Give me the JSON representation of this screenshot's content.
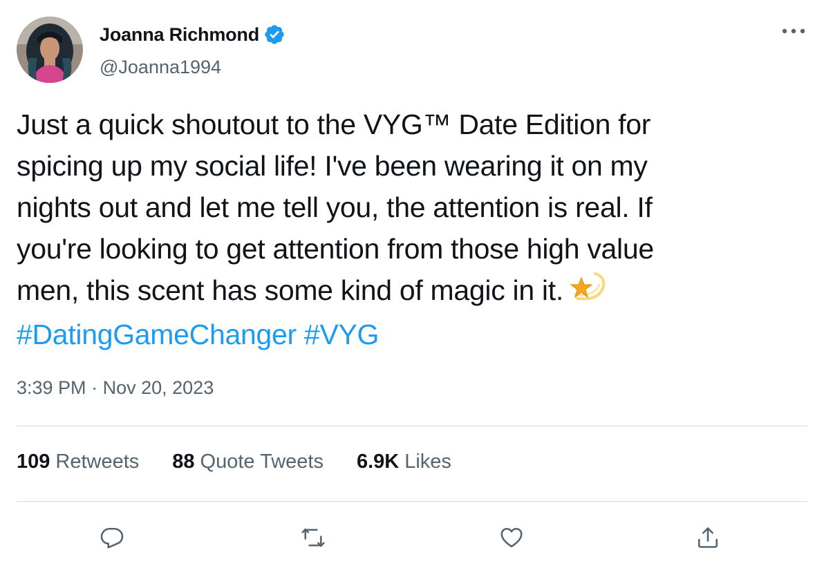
{
  "author": {
    "name": "Joanna Richmond",
    "handle": "@Joanna1994",
    "verified": true,
    "avatar_icon": "profile-photo"
  },
  "tweet": {
    "lines": [
      "Just a quick shoutout to the VYG™ Date Edition for",
      "spicing up my social life! I've been wearing it on my",
      "nights out and let me tell you, the attention is real. If",
      "you're looking to get attention from those high value",
      "men, this scent has some kind of magic in it."
    ],
    "emoji": "dizzy-star",
    "hashtags": [
      "#DatingGameChanger",
      "#VYG"
    ]
  },
  "meta": {
    "time": "3:39 PM",
    "separator": "·",
    "date": "Nov 20, 2023"
  },
  "stats": {
    "retweets_count": "109",
    "retweets_label": "Retweets",
    "quotes_count": "88",
    "quotes_label": "Quote Tweets",
    "likes_count": "6.9K",
    "likes_label": "Likes"
  },
  "actions": {
    "icons": [
      "reply-icon",
      "retweet-icon",
      "like-icon",
      "share-icon"
    ]
  },
  "colors": {
    "accent": "#1d9bf0",
    "text": "#0f1419",
    "secondary": "#536471",
    "divider": "#cfd9de"
  }
}
